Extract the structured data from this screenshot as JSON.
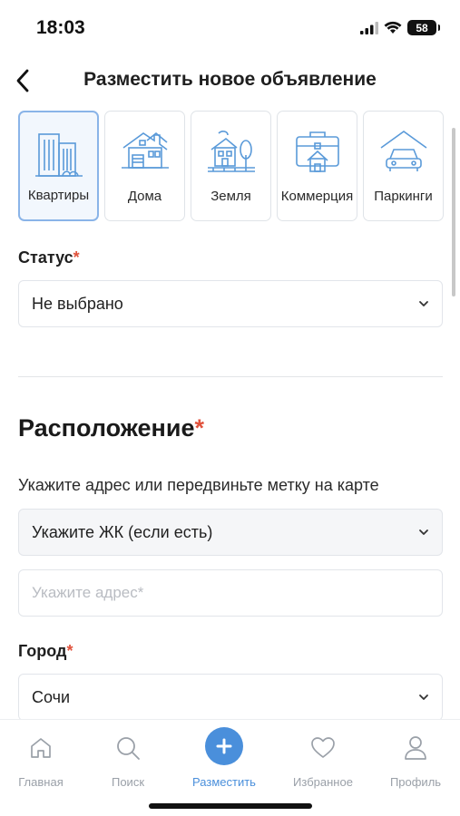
{
  "status_bar": {
    "time": "18:03",
    "battery": "58"
  },
  "header": {
    "title": "Разместить новое объявление"
  },
  "categories": [
    {
      "label": "Квартиры",
      "icon": "apartment-building-icon",
      "active": true
    },
    {
      "label": "Дома",
      "icon": "house-icon",
      "active": false
    },
    {
      "label": "Земля",
      "icon": "land-plot-icon",
      "active": false
    },
    {
      "label": "Коммерция",
      "icon": "commercial-briefcase-icon",
      "active": false
    },
    {
      "label": "Паркинги",
      "icon": "parking-garage-icon",
      "active": false
    }
  ],
  "status_field": {
    "label": "Статус",
    "required_mark": "*",
    "value": "Не выбрано"
  },
  "location": {
    "title": "Расположение",
    "required_mark": "*",
    "hint": "Укажите адрес или передвиньте метку на карте",
    "complex_select": {
      "value": "Укажите ЖК (если есть)"
    },
    "address_input": {
      "placeholder": "Укажите адрес*",
      "value": ""
    }
  },
  "city_field": {
    "label": "Город",
    "required_mark": "*",
    "value": "Сочи"
  },
  "tabbar": {
    "items": [
      {
        "label": "Главная",
        "icon": "home-icon"
      },
      {
        "label": "Поиск",
        "icon": "search-icon"
      },
      {
        "label": "Разместить",
        "icon": "plus-icon",
        "active": true
      },
      {
        "label": "Избранное",
        "icon": "heart-icon"
      },
      {
        "label": "Профиль",
        "icon": "user-icon"
      }
    ]
  },
  "colors": {
    "accent": "#4a8fdb",
    "required": "#e0523c",
    "icon_line": "#5a9ad9"
  }
}
